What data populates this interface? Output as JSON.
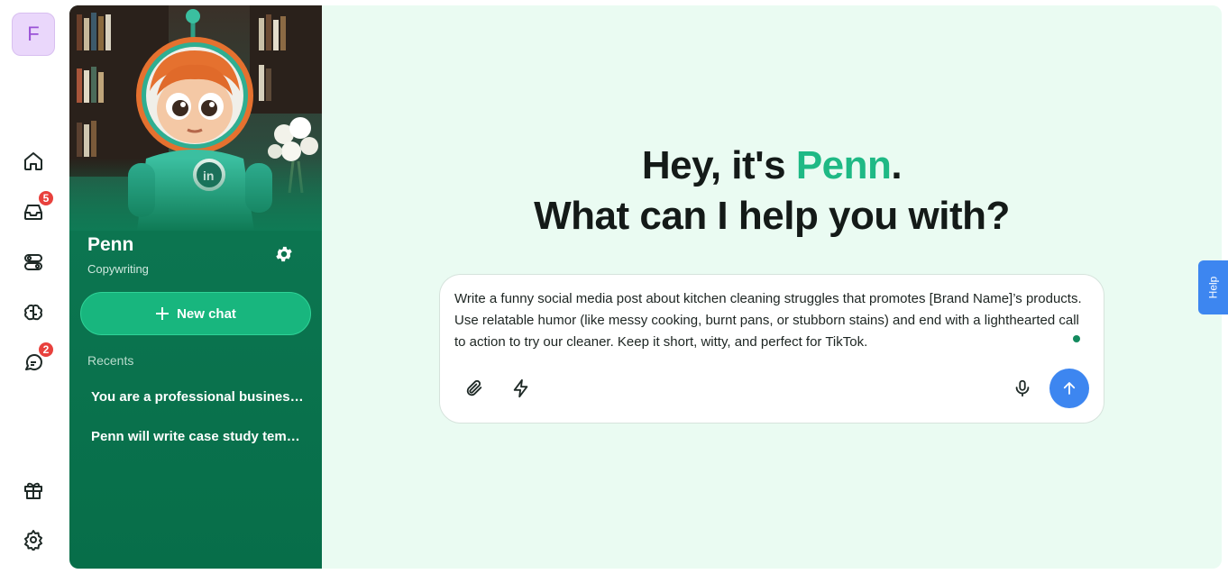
{
  "user": {
    "initial": "F"
  },
  "rail": {
    "items": [
      {
        "icon": "home-icon"
      },
      {
        "icon": "inbox-icon",
        "badge": "5"
      },
      {
        "icon": "toggles-icon"
      },
      {
        "icon": "brain-icon"
      },
      {
        "icon": "chat-icon",
        "badge": "2"
      },
      {
        "icon": "gift-icon"
      },
      {
        "icon": "gear-icon"
      }
    ]
  },
  "agent": {
    "name": "Penn",
    "role": "Copywriting",
    "new_chat_label": "New chat",
    "recents_label": "Recents",
    "recents": [
      "You are a professional business consultant",
      "Penn will write case study templates"
    ]
  },
  "main": {
    "greeting_prefix": "Hey, it's ",
    "greeting_name": "Penn",
    "greeting_suffix": ".",
    "question": "What can I help you with?",
    "prompt_text": "Write a funny social media post about kitchen cleaning struggles that promotes [Brand Name]’s products. Use relatable humor (like messy cooking, burnt pans, or stubborn stains) and end with a lighthearted call to action to try our cleaner. Keep it short, witty, and perfect for TikTok."
  },
  "help_label": "Help",
  "colors": {
    "accent": "#1fb985",
    "panel": "#0f7a55",
    "send": "#3d86f0",
    "badge": "#e8413d"
  }
}
